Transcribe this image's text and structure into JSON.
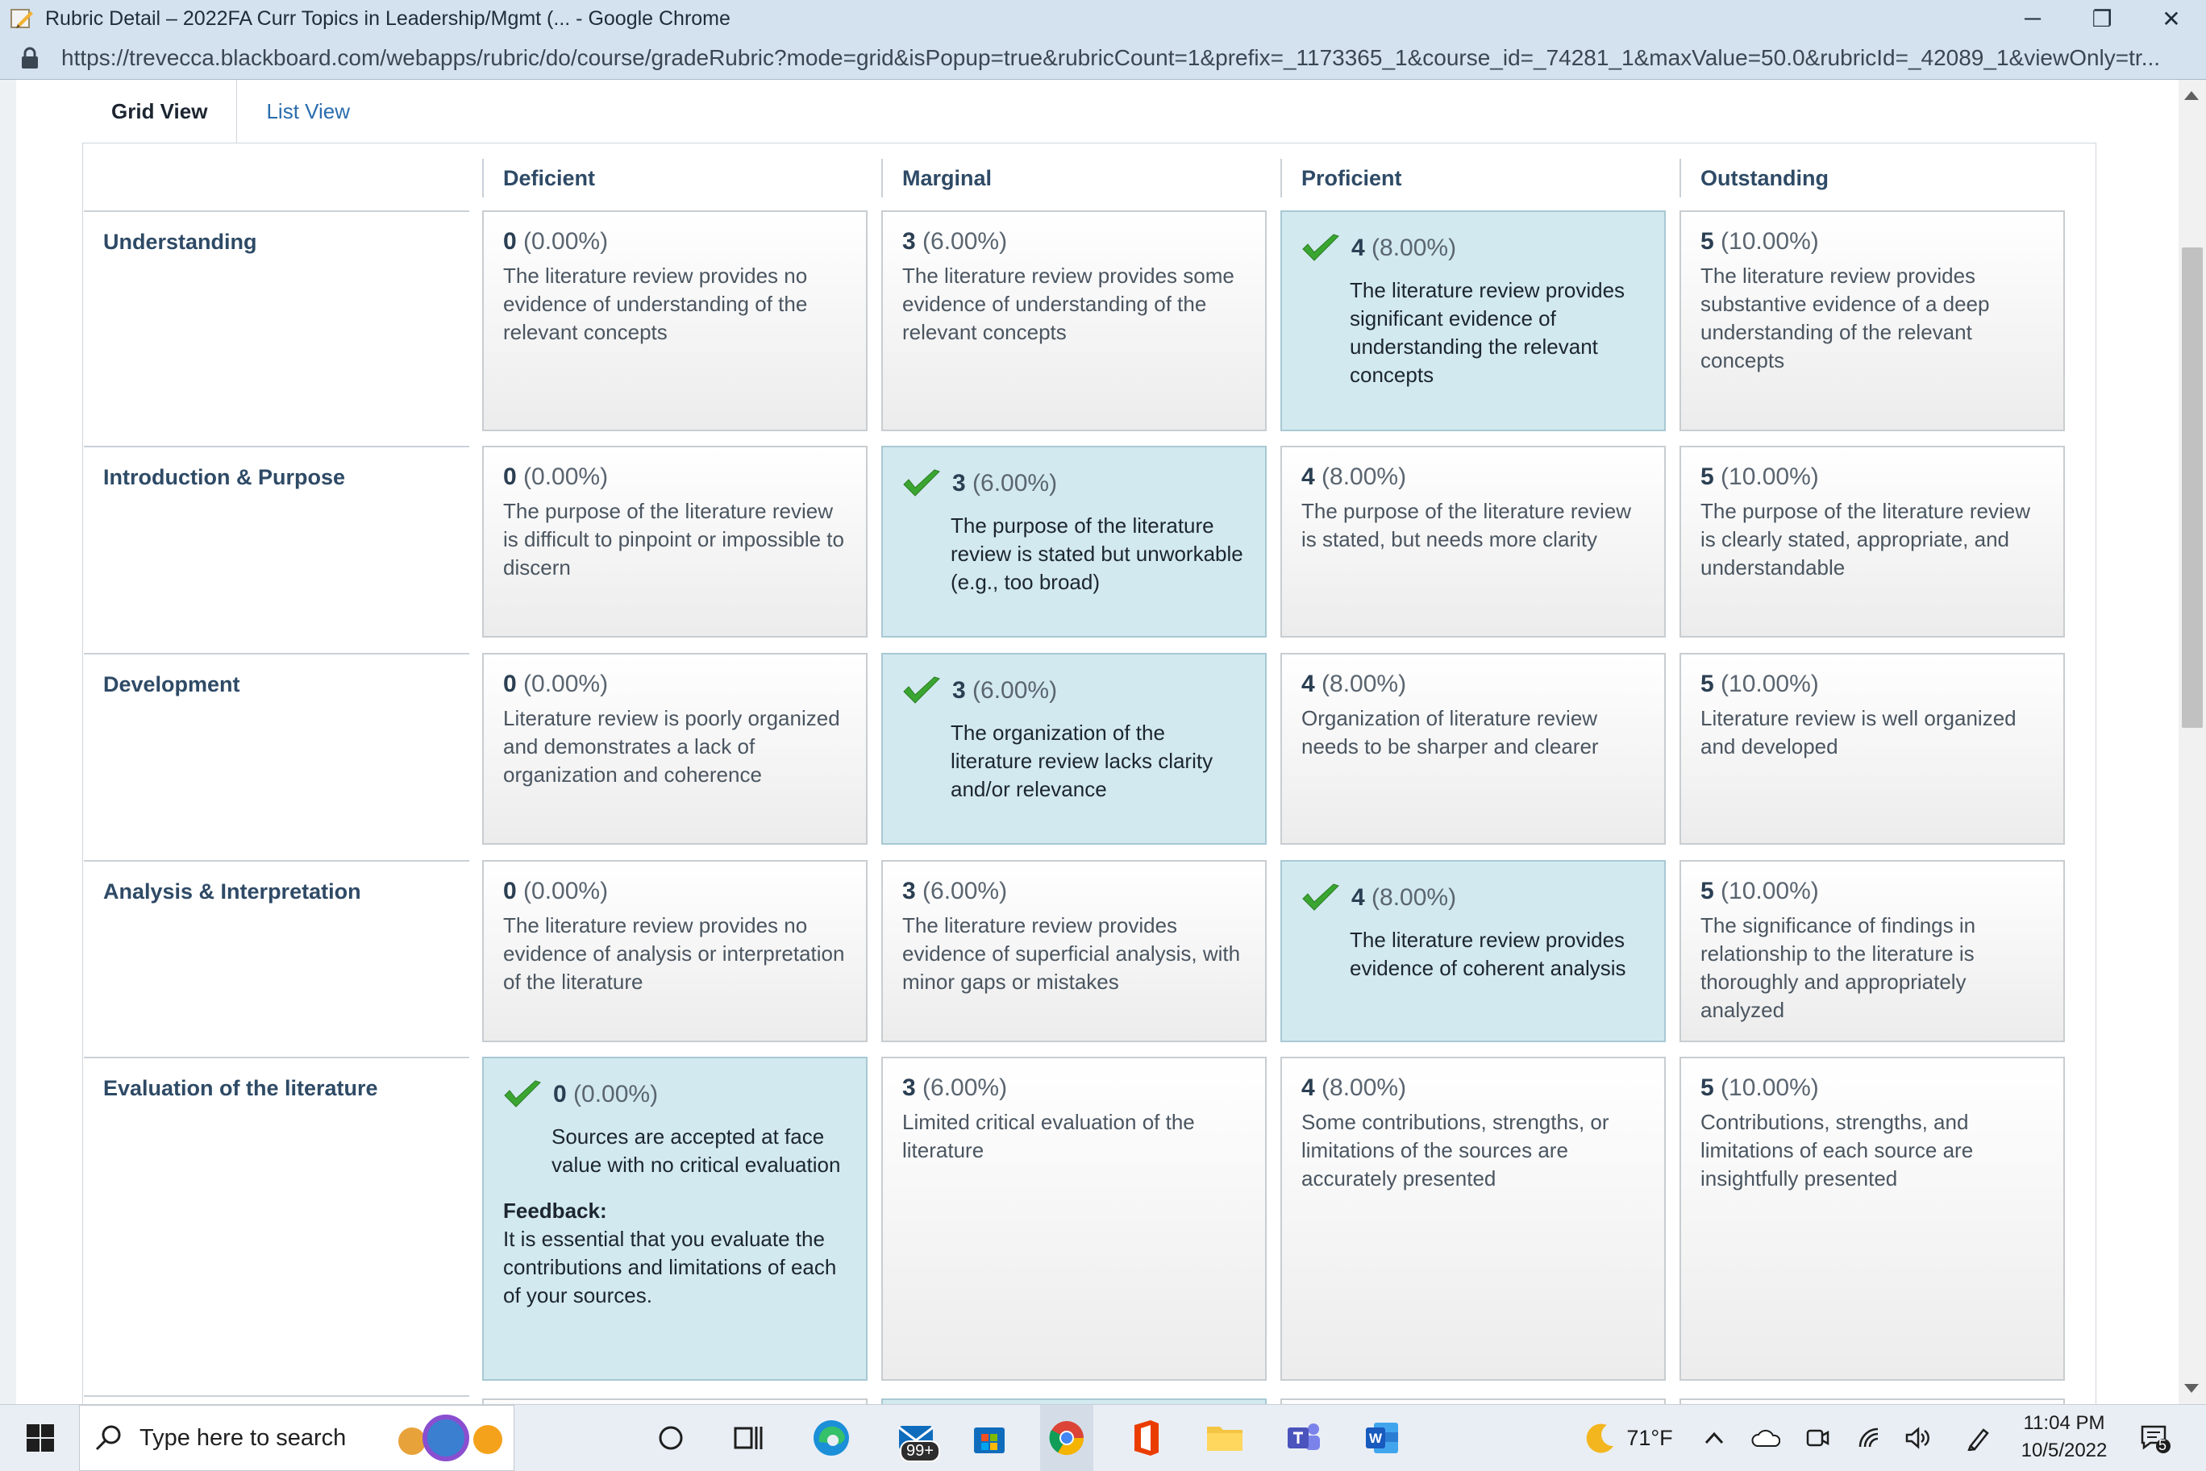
{
  "window": {
    "title": "Rubric Detail – 2022FA Curr Topics in Leadership/Mgmt (... - Google Chrome",
    "minimize": "─",
    "restore": "❐",
    "close": "✕"
  },
  "address": {
    "url": "https://trevecca.blackboard.com/webapps/rubric/do/course/gradeRubric?mode=grid&isPopup=true&rubricCount=1&prefix=_1173365_1&course_id=_74281_1&maxValue=50.0&rubricId=_42089_1&viewOnly=tr..."
  },
  "tabs": {
    "grid": "Grid View",
    "list": "List View"
  },
  "columns": [
    "Deficient",
    "Marginal",
    "Proficient",
    "Outstanding"
  ],
  "rows": [
    {
      "name": "Understanding",
      "cells": [
        {
          "points": "0",
          "percent": "(0.00%)",
          "desc": "The literature review provides no evidence of understanding of the relevant concepts",
          "selected": false
        },
        {
          "points": "3",
          "percent": "(6.00%)",
          "desc": "The literature review provides some evidence of understanding of the relevant concepts",
          "selected": false
        },
        {
          "points": "4",
          "percent": "(8.00%)",
          "desc": "The literature review provides significant evidence of understanding the relevant concepts",
          "selected": true
        },
        {
          "points": "5",
          "percent": "(10.00%)",
          "desc": "The literature review provides substantive evidence of a deep understanding of the relevant concepts",
          "selected": false
        }
      ]
    },
    {
      "name": "Introduction & Purpose",
      "cells": [
        {
          "points": "0",
          "percent": "(0.00%)",
          "desc": "The purpose of the literature review is difficult to pinpoint or impossible to discern",
          "selected": false
        },
        {
          "points": "3",
          "percent": "(6.00%)",
          "desc": "The purpose of the literature review is stated but unworkable (e.g., too broad)",
          "selected": true
        },
        {
          "points": "4",
          "percent": "(8.00%)",
          "desc": "The purpose of the literature review is stated, but needs more clarity",
          "selected": false
        },
        {
          "points": "5",
          "percent": "(10.00%)",
          "desc": "The purpose of the literature review is clearly stated, appropriate, and understandable",
          "selected": false
        }
      ]
    },
    {
      "name": "Development",
      "cells": [
        {
          "points": "0",
          "percent": "(0.00%)",
          "desc": "Literature review is poorly organized and demonstrates a lack of organization and coherence",
          "selected": false
        },
        {
          "points": "3",
          "percent": "(6.00%)",
          "desc": "The organization of the literature review lacks clarity and/or relevance",
          "selected": true
        },
        {
          "points": "4",
          "percent": "(8.00%)",
          "desc": "Organization of literature review needs to be sharper and clearer",
          "selected": false
        },
        {
          "points": "5",
          "percent": "(10.00%)",
          "desc": "Literature review is well organized and developed",
          "selected": false
        }
      ]
    },
    {
      "name": "Analysis & Interpretation",
      "cells": [
        {
          "points": "0",
          "percent": "(0.00%)",
          "desc": "The literature review provides no evidence of analysis or interpretation of the literature",
          "selected": false
        },
        {
          "points": "3",
          "percent": "(6.00%)",
          "desc": "The literature review provides evidence of superficial analysis, with minor gaps or mistakes",
          "selected": false
        },
        {
          "points": "4",
          "percent": "(8.00%)",
          "desc": "The literature review provides evidence of coherent analysis",
          "selected": true
        },
        {
          "points": "5",
          "percent": "(10.00%)",
          "desc": "The significance of findings in relationship to the literature is thoroughly and appropriately analyzed",
          "selected": false
        }
      ]
    },
    {
      "name": "Evaluation of the literature",
      "cells": [
        {
          "points": "0",
          "percent": "(0.00%)",
          "desc": "Sources are accepted at face value with no critical evaluation",
          "selected": true,
          "feedback_label": "Feedback:",
          "feedback": "It is essential that you evaluate the contributions and limitations of each of your sources."
        },
        {
          "points": "3",
          "percent": "(6.00%)",
          "desc": "Limited critical evaluation of the literature",
          "selected": false
        },
        {
          "points": "4",
          "percent": "(8.00%)",
          "desc": "Some contributions, strengths, or limitations of the sources are accurately presented",
          "selected": false
        },
        {
          "points": "5",
          "percent": "(10.00%)",
          "desc": "Contributions, strengths, and limitations of each source are insightfully presented",
          "selected": false
        }
      ]
    }
  ],
  "taskbar": {
    "search_placeholder": "Type here to search",
    "mail_badge": "99+",
    "weather": "71°F",
    "time": "11:04 PM",
    "date": "10/5/2022",
    "notifications": "5"
  },
  "colors": {
    "selected_bg": "#d2e9ef",
    "check_green": "#3aa631",
    "link": "#2a6dad"
  }
}
